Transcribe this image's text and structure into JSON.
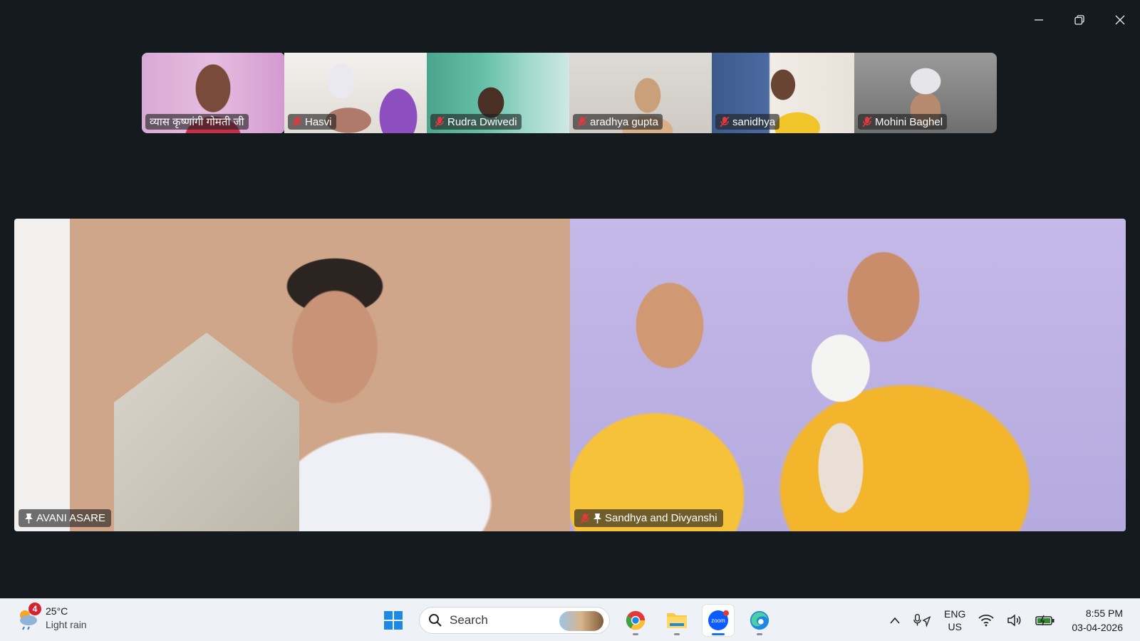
{
  "window": {
    "controls": [
      {
        "name": "minimize-button",
        "icon": "minimize-icon"
      },
      {
        "name": "restore-button",
        "icon": "restore-icon"
      },
      {
        "name": "close-button",
        "icon": "close-icon"
      }
    ]
  },
  "gallery": {
    "active_color": "#2ee59d",
    "participants": [
      {
        "name": "व्यास कृष्णांगी गोमती जी",
        "muted": false,
        "active": true
      },
      {
        "name": "Hasvi",
        "muted": true,
        "active": false
      },
      {
        "name": "Rudra Dwivedi",
        "muted": true,
        "active": false
      },
      {
        "name": "aradhya gupta",
        "muted": true,
        "active": false
      },
      {
        "name": "sanidhya",
        "muted": true,
        "active": false
      },
      {
        "name": "Mohini Baghel",
        "muted": true,
        "active": false
      }
    ]
  },
  "spotlight": [
    {
      "name": "AVANI ASARE",
      "muted": false,
      "pinned": true
    },
    {
      "name": "Sandhya and Divyanshi",
      "muted": true,
      "pinned": true
    }
  ],
  "taskbar": {
    "weather": {
      "badge": "4",
      "temp": "25°C",
      "condition": "Light rain"
    },
    "search_placeholder": "Search",
    "apps": [
      "windows-start",
      "chrome",
      "file-explorer",
      "zoom",
      "edge-copilot"
    ],
    "language": {
      "line1": "ENG",
      "line2": "US"
    },
    "clock": {
      "time": "8:55 PM",
      "date": "03-04-2026"
    }
  }
}
